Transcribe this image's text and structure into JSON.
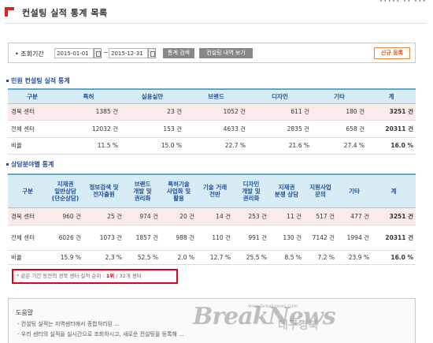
{
  "header": {
    "top_links": "∙∙∙∙∙  ∙∙  ∙∙∙",
    "title": "컨설팅 실적 통계 목록"
  },
  "search": {
    "label": "조회기간",
    "from": "2015-01-01",
    "to": "2015-12-31",
    "tilde": "~",
    "btn_search": "통계 검색",
    "btn_history": "컨설팅 내역 보기",
    "btn_new": "신규 등록"
  },
  "section1": {
    "title": "민원 컨설팅 실적 통계",
    "headers": [
      "구분",
      "특허",
      "실용실안",
      "브랜드",
      "디자인",
      "기타",
      "계"
    ],
    "rows": [
      [
        "경북 센터",
        "1385 건",
        "23 건",
        "1052 건",
        "611 건",
        "180 건",
        "3251 건"
      ],
      [
        "전체 센터",
        "12032 건",
        "153 건",
        "4633 건",
        "2835 건",
        "658 건",
        "20311 건"
      ],
      [
        "비율",
        "11.5 %",
        "15.0 %",
        "22.7 %",
        "21.6 %",
        "27.4 %",
        "16.0 %"
      ]
    ]
  },
  "section2": {
    "title": "상담분야별 통계",
    "headers": [
      "구분",
      "지재권\n일반상담\n(단순상담)",
      "정보검색 및\n전자출원",
      "브랜드\n개발 및\n권리화",
      "특허기술\n사업화 및\n활용",
      "기술 거래\n전반",
      "디자인\n개발 및\n권리화",
      "지재권\n분쟁 상담",
      "지원사업\n문의",
      "기타",
      "계"
    ],
    "rows": [
      [
        "경북 센터",
        "960 건",
        "25 건",
        "974 건",
        "20 건",
        "14 건",
        "253 건",
        "11 건",
        "517 건",
        "477 건",
        "3251 건"
      ],
      [
        "전체 센터",
        "6026 건",
        "1073 건",
        "1857 건",
        "988 건",
        "110 건",
        "991 건",
        "130 건",
        "7142 건",
        "1994 건",
        "20311 건"
      ],
      [
        "비율",
        "15.9 %",
        "2.3 %",
        "52.5 %",
        "2.0 %",
        "12.7 %",
        "25.5 %",
        "8.5 %",
        "7.2 %",
        "23.9 %",
        "16.0 %"
      ]
    ]
  },
  "notice": {
    "prefix": "* 같은 기간 동안의 경북 센터 실적 순위 : ",
    "rank": "1위",
    "suffix": " / 32개 센터"
  },
  "help": {
    "title": "도움말",
    "line1": "- 컨설팅 실적는 지역센터에서 종합처리된 ...",
    "line2": "- 우리 센터의 실적을 실시간으로 조회하시고, 새로운 컨설팅을 등록해 ..."
  },
  "watermark": {
    "logo": "BreakNews",
    "korean": "대구경북",
    "small": "www.breaknews.com"
  }
}
